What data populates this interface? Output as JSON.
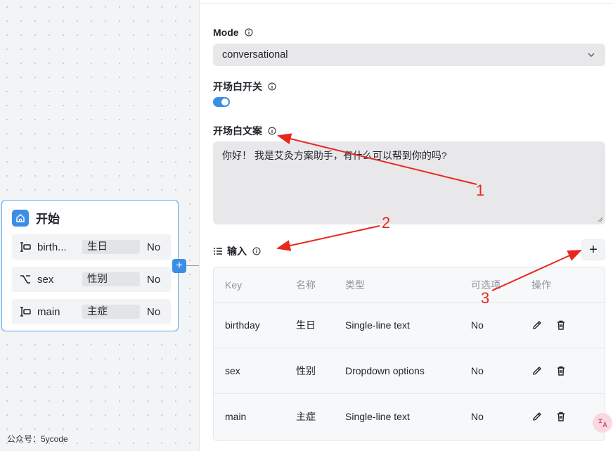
{
  "node": {
    "title": "开始",
    "fields": [
      {
        "name": "birth...",
        "label": "生日",
        "required": "No",
        "icon": "text-field-icon"
      },
      {
        "name": "sex",
        "label": "性别",
        "required": "No",
        "icon": "select-field-icon"
      },
      {
        "name": "main",
        "label": "主症",
        "required": "No",
        "icon": "text-field-icon"
      }
    ],
    "add_handle": "+"
  },
  "watermark": "公众号：5ycode",
  "panel": {
    "mode_label": "Mode",
    "mode_value": "conversational",
    "opening_switch_label": "开场白开关",
    "opening_text_label": "开场白文案",
    "opening_text": "你好！ 我是艾灸方案助手，有什么可以帮到你的吗?",
    "inputs_label": "输入",
    "add_button": "+",
    "table": {
      "headers": [
        "Key",
        "名称",
        "类型",
        "可选项",
        "操作"
      ],
      "rows": [
        {
          "key": "birthday",
          "name": "生日",
          "type": "Single-line text",
          "optional": "No"
        },
        {
          "key": "sex",
          "name": "性别",
          "type": "Dropdown options",
          "optional": "No"
        },
        {
          "key": "main",
          "name": "主症",
          "type": "Single-line text",
          "optional": "No"
        }
      ]
    }
  },
  "annotations": [
    "1",
    "2",
    "3"
  ],
  "colors": {
    "accent": "#3a8ee6",
    "annotation": "#e8281e"
  }
}
